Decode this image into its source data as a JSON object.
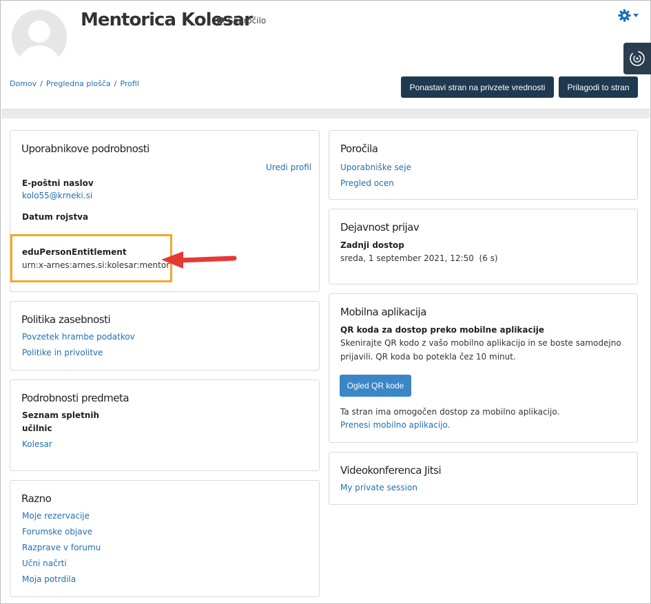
{
  "header": {
    "user_name": "Mentorica Kolesar",
    "message_label": "Sporočilo",
    "icons": [
      "user-avatar",
      "speech-bubble-icon",
      "gear-icon",
      "caret-down-icon",
      "drawer-toggle-icon"
    ]
  },
  "breadcrumb": [
    "Domov",
    "Pregledna plošča",
    "Profil"
  ],
  "buttons": {
    "reset": "Ponastavi stran na privzete vrednosti",
    "customize": "Prilagodi to stran"
  },
  "user_details": {
    "title": "Uporabnikove podrobnosti",
    "edit_link": "Uredi profil",
    "email_label": "E-poštni naslov",
    "email_value": "kolo55@krneki.si",
    "birth_label": "Datum rojstva",
    "entitlement_label": "eduPersonEntitlement",
    "entitlement_value": "urn:x-arnes:arnes.si:kolesar:mentor"
  },
  "privacy": {
    "title": "Politika zasebnosti",
    "links": [
      "Povzetek hrambe podatkov",
      "Politike in privolitve"
    ]
  },
  "course_details": {
    "title": "Podrobnosti predmeta",
    "list_label_1": "Seznam spletnih",
    "list_label_2": "učilnic",
    "course": "Kolesar"
  },
  "misc": {
    "title": "Razno",
    "links": [
      "Moje rezervacije",
      "Forumske objave",
      "Razprave v forumu",
      "Učni načrti",
      "Moja potrdila"
    ]
  },
  "reports": {
    "title": "Poročila",
    "links": [
      "Uporabniške seje",
      "Pregled ocen"
    ]
  },
  "login_activity": {
    "title": "Dejavnost prijav",
    "last_access_label": "Zadnji dostop",
    "last_access_value": "sreda, 1 september 2021, 12:50  (6 s)"
  },
  "mobile": {
    "title": "Mobilna aplikacija",
    "qr_label": "QR koda za dostop preko mobilne aplikacije",
    "desc_1": "Skenirajte QR kodo z vašo mobilno aplikacijo in se boste samodejno",
    "desc_2": "prijavili. QR koda bo potekla čez 10 minut.",
    "qr_button": "Ogled QR kode",
    "access_note": "Ta stran ima omogočen dostop za mobilno aplikacijo.",
    "download_link": "Prenesi mobilno aplikacijo."
  },
  "jitsi": {
    "title": "Videokonferenca Jitsi",
    "session_link": "My private session"
  },
  "colors": {
    "link": "#1f6fb2",
    "dark_button": "#1f3a50",
    "primary_button": "#3b86c7",
    "highlight": "#f5a623",
    "arrow": "#e53935"
  }
}
